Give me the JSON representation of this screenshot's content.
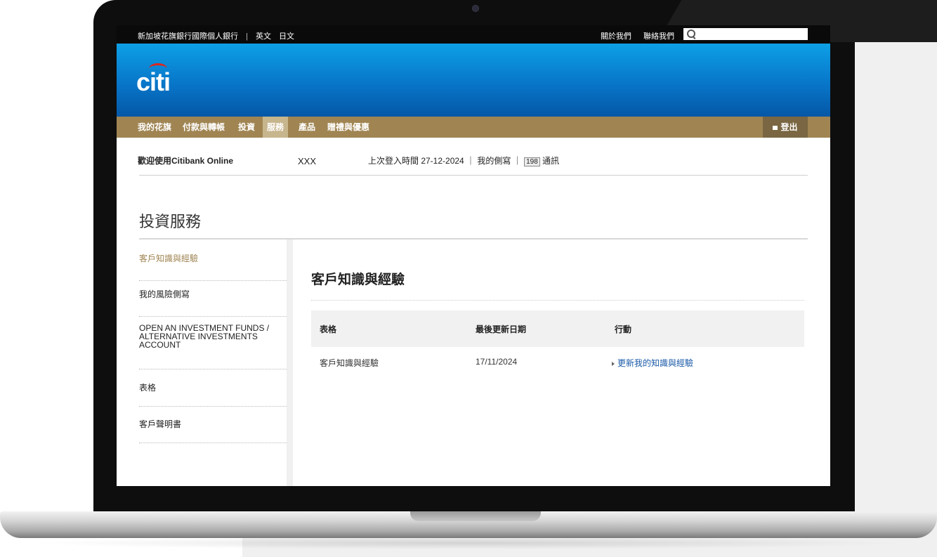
{
  "top_bar": {
    "site_name": "新加坡花旗銀行國際個人銀行",
    "separator": "|",
    "lang_en": "英文",
    "lang_jp": "日文",
    "about": "關於我們",
    "contact": "聯絡我們",
    "search_placeholder": ""
  },
  "logo_text": "citi",
  "nav": {
    "items": [
      "我的花旗",
      "付款與轉帳",
      "投資",
      "服務",
      "產品",
      "贈禮與優惠"
    ],
    "active": "服務",
    "logout": "登出"
  },
  "welcome": {
    "text": "歡迎使用Citibank Online",
    "username": "XXX",
    "last_login": "上次登入時間 27-12-2024 ｜ 我的側寫 ｜",
    "messages_count": "198",
    "messages_label": "通訊"
  },
  "page_title": "投資服務",
  "sidebar": {
    "items": [
      "客戶知識與經驗",
      "我的風險側寫",
      "OPEN AN INVESTMENT FUNDS / ALTERNATIVE INVESTMENTS ACCOUNT",
      "表格",
      "客戶聲明書"
    ]
  },
  "content": {
    "title": "客戶知識與經驗",
    "columns": [
      "表格",
      "最後更新日期",
      "行動"
    ],
    "rows": [
      {
        "form": "客戶知識與經驗",
        "date": "17/11/2024",
        "action": "更新我的知識與經驗"
      }
    ]
  },
  "colors": {
    "nav_gold": "#a08553",
    "banner_blue": "#0876c9",
    "link_blue": "#1a5aa8"
  }
}
